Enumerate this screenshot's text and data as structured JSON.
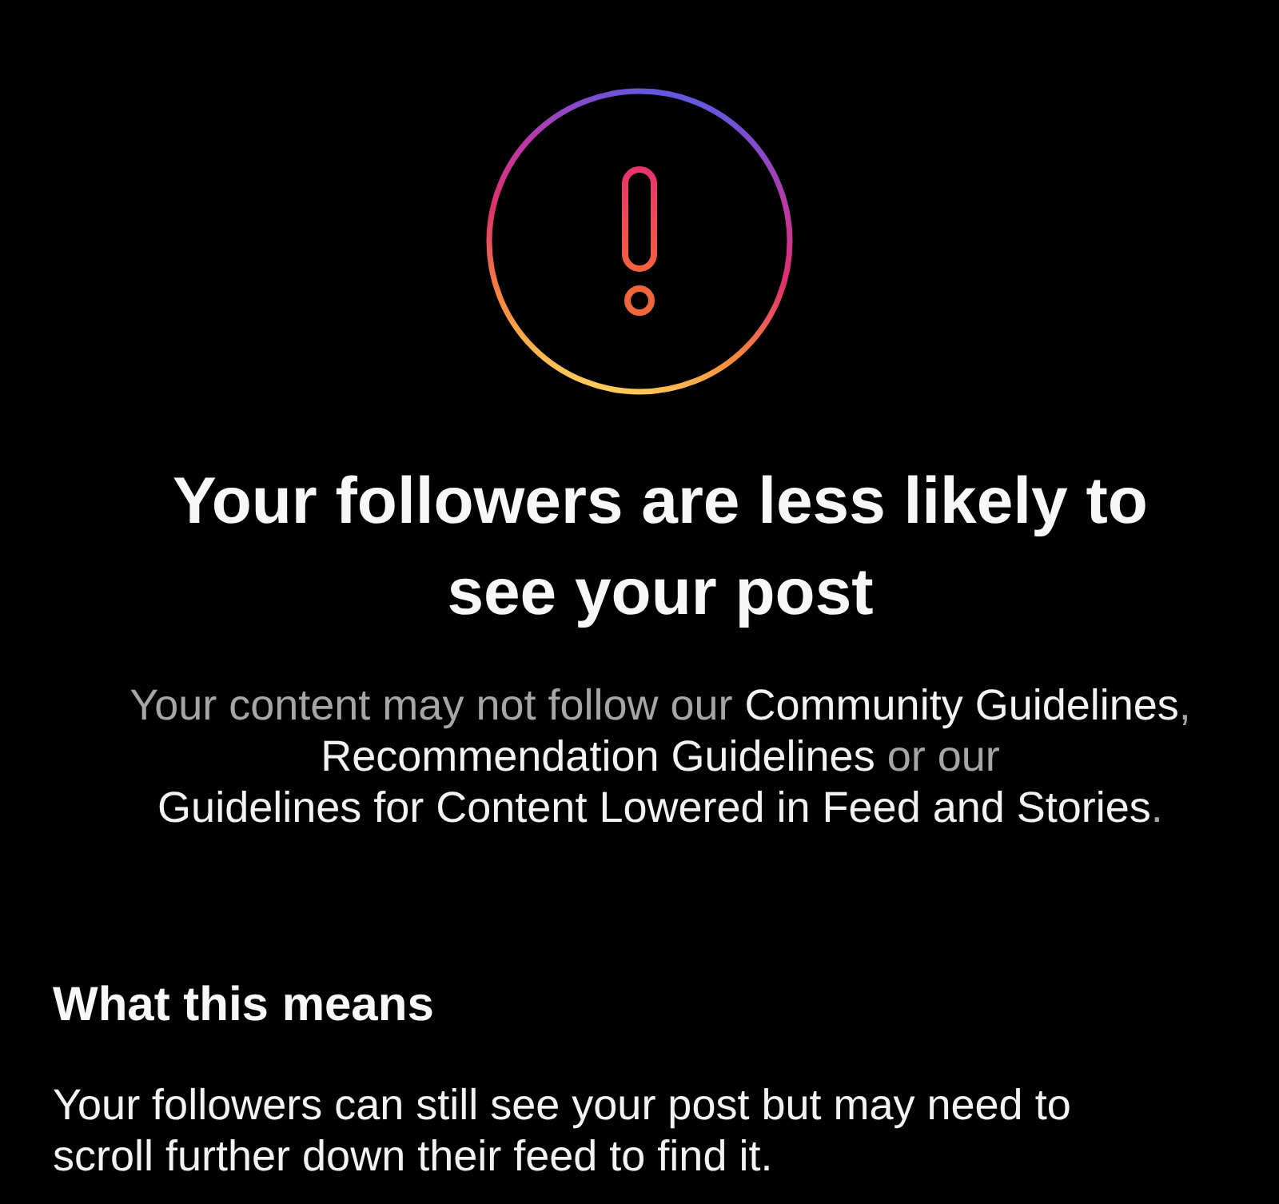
{
  "notice": {
    "title": "Your followers are less likely to see your post",
    "description": [
      {
        "kind": "text",
        "text": "Your content may not follow our "
      },
      {
        "kind": "link",
        "text": "Community Guidelines"
      },
      {
        "kind": "text",
        "text": ", "
      },
      {
        "kind": "link",
        "text": "Recommendation Guidelines"
      },
      {
        "kind": "text",
        "text": " or our "
      },
      {
        "kind": "link",
        "text": "Guidelines for Content Lowered in Feed and Stories"
      },
      {
        "kind": "text",
        "text": "."
      }
    ]
  },
  "section": {
    "heading": "What this means",
    "body": "Your followers can still see your post but may need to scroll further down their feed to find it."
  }
}
